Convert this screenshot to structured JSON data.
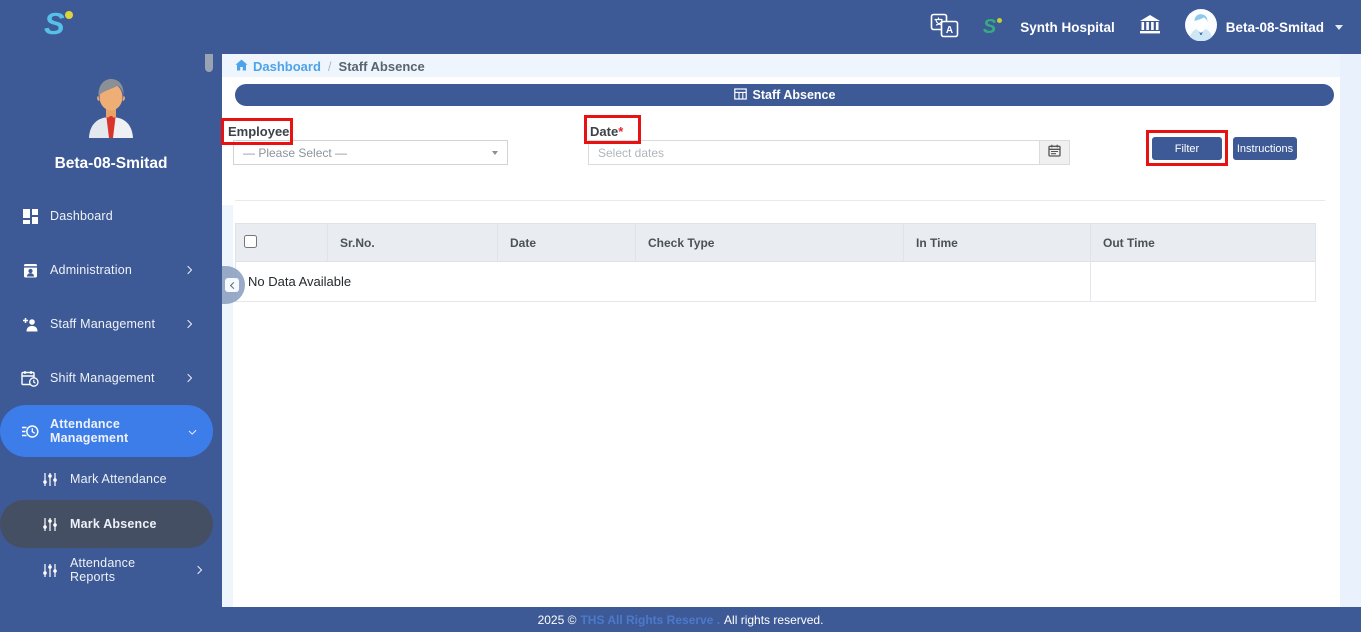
{
  "app": {
    "brand_letter": "S"
  },
  "navbar": {
    "hospital_name": "Synth Hospital",
    "user_name": "Beta-08-Smitad"
  },
  "sidebar": {
    "profile_name": "Beta-08-Smitad",
    "items": [
      {
        "label": "Dashboard",
        "active": false
      },
      {
        "label": "Administration",
        "active": false
      },
      {
        "label": "Staff Management",
        "active": false
      },
      {
        "label": "Shift Management",
        "active": false
      },
      {
        "label": "Attendance Management",
        "active": true
      }
    ],
    "subitems": [
      {
        "label": "Mark Attendance",
        "active": false
      },
      {
        "label": "Mark Absence",
        "active": true
      },
      {
        "label": "Attendance Reports",
        "active": false
      }
    ]
  },
  "breadcrumb": {
    "home_label": "Dashboard",
    "separator": "/",
    "current": "Staff Absence"
  },
  "panel": {
    "title": "Staff Absence"
  },
  "form": {
    "employee_label": "Employee",
    "employee_selected": "— Please Select —",
    "date_label": "Date",
    "required_mark": "*",
    "date_placeholder": "Select dates",
    "filter_button": "Filter",
    "instructions_button": "Instructions"
  },
  "table": {
    "headers": {
      "srno": "Sr.No.",
      "date": "Date",
      "check_type": "Check Type",
      "in_time": "In Time",
      "out_time": "Out Time"
    },
    "empty_message": "No Data Available"
  },
  "footer": {
    "prefix": "2025 ©",
    "link_text": "THS All Rights Reserve .",
    "suffix": "All rights reserved."
  },
  "colors": {
    "navbar": "#3d5a96",
    "active_item": "#3d7de9",
    "active_subitem": "#454f63",
    "annotation_red": "#e81212",
    "breadcrumb_link": "#4ea3e9",
    "footer_link": "#4d79cc",
    "table_header_bg": "#e9edf1"
  },
  "icons": {
    "language-icon": "translate-book",
    "brand-icon": "italic-S-with-dot",
    "bank-icon": "classical-building",
    "user-avatar": "person-circle",
    "home-icon": "house",
    "table-grid-icon": "grid",
    "calendar-icon": "calendar",
    "sliders-icon": "vertical-sliders"
  }
}
